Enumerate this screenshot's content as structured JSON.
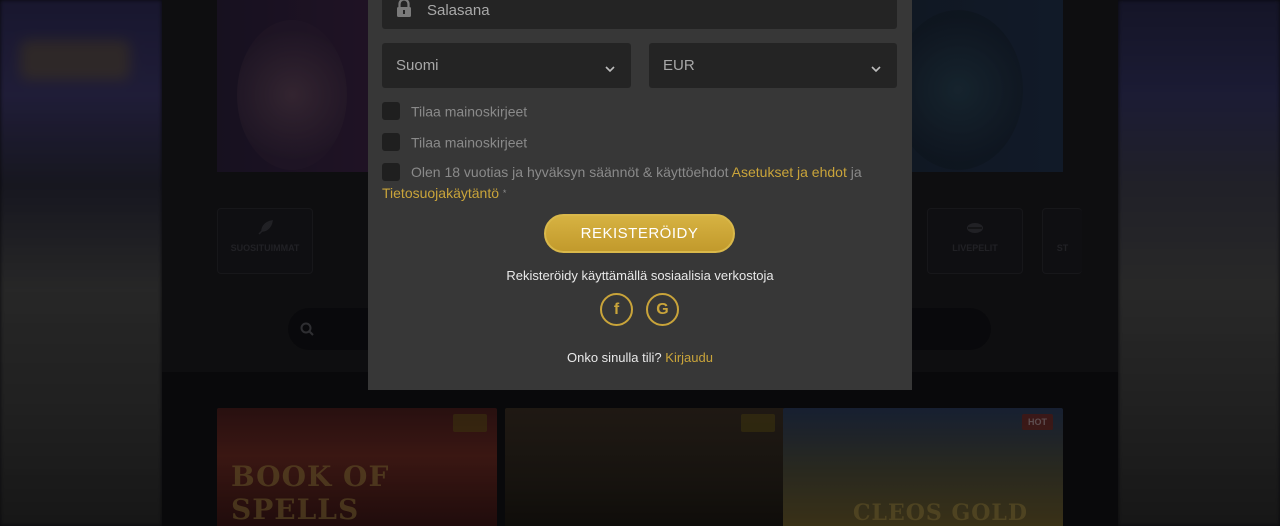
{
  "background": {
    "categories": [
      {
        "label": "SUOSITUIMMAT",
        "icon": "rocket-icon"
      },
      {
        "label": "",
        "icon": "blank"
      },
      {
        "label": "LIVEPELIT",
        "icon": "lips-icon"
      },
      {
        "label": "ST",
        "icon": "blank"
      }
    ],
    "games": [
      {
        "title": "BOOK OF SPELLS",
        "badge": ""
      },
      {
        "title": "",
        "badge": ""
      },
      {
        "title": "CLEOS GOLD",
        "badge": "HOT"
      }
    ]
  },
  "modal": {
    "password": {
      "placeholder": "Salasana"
    },
    "language_select": {
      "value": "Suomi"
    },
    "currency_select": {
      "value": "EUR"
    },
    "checkboxes": [
      {
        "label": "Tilaa mainoskirjeet"
      },
      {
        "label": "Tilaa mainoskirjeet"
      }
    ],
    "terms": {
      "text": "Olen 18 vuotias ja hyväksyn säännöt & käyttöehdot",
      "link1": "Asetukset ja ehdot",
      "joiner": "ja",
      "link2": "Tietosuojakäytäntö",
      "required_mark": "*"
    },
    "register_button": "REKISTERÖIDY",
    "social_label": "Rekisteröidy käyttämällä sosiaalisia verkostoja",
    "social": [
      {
        "name": "facebook",
        "glyph": "f"
      },
      {
        "name": "google",
        "glyph": "G"
      }
    ],
    "login_prompt": "Onko sinulla tili?",
    "login_link": "Kirjaudu"
  },
  "colors": {
    "accent": "#c9a43a",
    "modal_bg": "#373737",
    "field_bg": "#242424"
  }
}
